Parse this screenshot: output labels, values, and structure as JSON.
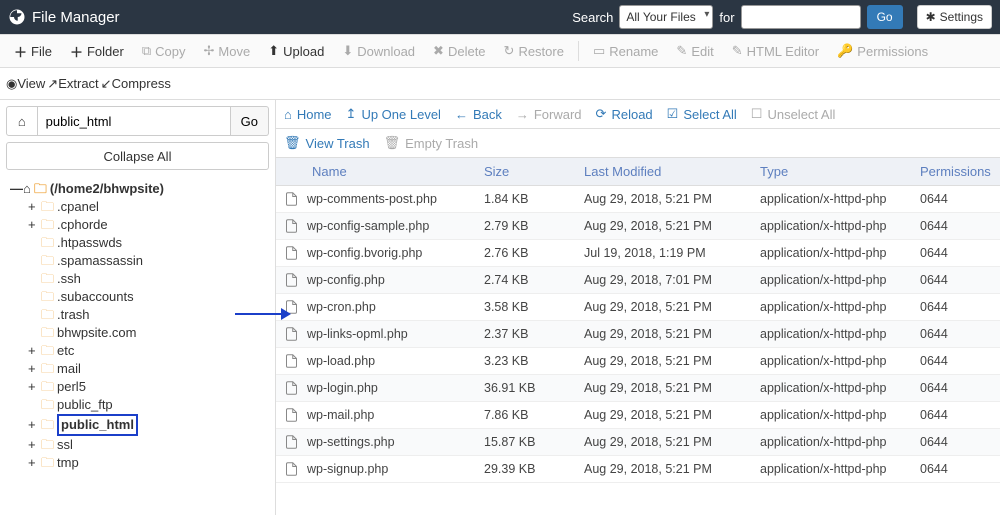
{
  "brand": "File Manager",
  "search": {
    "label": "Search",
    "select": "All Your Files",
    "for": "for",
    "go": "Go",
    "settings": "Settings"
  },
  "toolbar": {
    "file": "File",
    "folder": "Folder",
    "copy": "Copy",
    "move": "Move",
    "upload": "Upload",
    "download": "Download",
    "delete": "Delete",
    "restore": "Restore",
    "rename": "Rename",
    "edit": "Edit",
    "htmleditor": "HTML Editor",
    "permissions": "Permissions",
    "view": "View",
    "extract": "Extract",
    "compress": "Compress"
  },
  "sidebar": {
    "path": "public_html",
    "go": "Go",
    "collapse": "Collapse All",
    "root": "(/home2/bhwpsite)",
    "items": [
      {
        "exp": "+",
        "name": ".cpanel"
      },
      {
        "exp": "+",
        "name": ".cphorde"
      },
      {
        "exp": "",
        "name": ".htpasswds"
      },
      {
        "exp": "",
        "name": ".spamassassin"
      },
      {
        "exp": "",
        "name": ".ssh"
      },
      {
        "exp": "",
        "name": ".subaccounts"
      },
      {
        "exp": "",
        "name": ".trash"
      },
      {
        "exp": "",
        "name": "bhwpsite.com"
      },
      {
        "exp": "+",
        "name": "etc"
      },
      {
        "exp": "+",
        "name": "mail"
      },
      {
        "exp": "+",
        "name": "perl5"
      },
      {
        "exp": "",
        "name": "public_ftp"
      },
      {
        "exp": "+",
        "name": "public_html",
        "hl": true
      },
      {
        "exp": "+",
        "name": "ssl"
      },
      {
        "exp": "+",
        "name": "tmp"
      }
    ]
  },
  "nav": {
    "home": "Home",
    "up": "Up One Level",
    "back": "Back",
    "forward": "Forward",
    "reload": "Reload",
    "selectall": "Select All",
    "unselectall": "Unselect All",
    "viewtrash": "View Trash",
    "emptytrash": "Empty Trash"
  },
  "columns": {
    "name": "Name",
    "size": "Size",
    "mod": "Last Modified",
    "type": "Type",
    "perm": "Permissions"
  },
  "files": [
    {
      "name": "wp-comments-post.php",
      "size": "1.84 KB",
      "mod": "Aug 29, 2018, 5:21 PM",
      "type": "application/x-httpd-php",
      "perm": "0644"
    },
    {
      "name": "wp-config-sample.php",
      "size": "2.79 KB",
      "mod": "Aug 29, 2018, 5:21 PM",
      "type": "application/x-httpd-php",
      "perm": "0644"
    },
    {
      "name": "wp-config.bvorig.php",
      "size": "2.76 KB",
      "mod": "Jul 19, 2018, 1:19 PM",
      "type": "application/x-httpd-php",
      "perm": "0644"
    },
    {
      "name": "wp-config.php",
      "size": "2.74 KB",
      "mod": "Aug 29, 2018, 7:01 PM",
      "type": "application/x-httpd-php",
      "perm": "0644"
    },
    {
      "name": "wp-cron.php",
      "size": "3.58 KB",
      "mod": "Aug 29, 2018, 5:21 PM",
      "type": "application/x-httpd-php",
      "perm": "0644"
    },
    {
      "name": "wp-links-opml.php",
      "size": "2.37 KB",
      "mod": "Aug 29, 2018, 5:21 PM",
      "type": "application/x-httpd-php",
      "perm": "0644"
    },
    {
      "name": "wp-load.php",
      "size": "3.23 KB",
      "mod": "Aug 29, 2018, 5:21 PM",
      "type": "application/x-httpd-php",
      "perm": "0644"
    },
    {
      "name": "wp-login.php",
      "size": "36.91 KB",
      "mod": "Aug 29, 2018, 5:21 PM",
      "type": "application/x-httpd-php",
      "perm": "0644"
    },
    {
      "name": "wp-mail.php",
      "size": "7.86 KB",
      "mod": "Aug 29, 2018, 5:21 PM",
      "type": "application/x-httpd-php",
      "perm": "0644"
    },
    {
      "name": "wp-settings.php",
      "size": "15.87 KB",
      "mod": "Aug 29, 2018, 5:21 PM",
      "type": "application/x-httpd-php",
      "perm": "0644"
    },
    {
      "name": "wp-signup.php",
      "size": "29.39 KB",
      "mod": "Aug 29, 2018, 5:21 PM",
      "type": "application/x-httpd-php",
      "perm": "0644"
    }
  ]
}
